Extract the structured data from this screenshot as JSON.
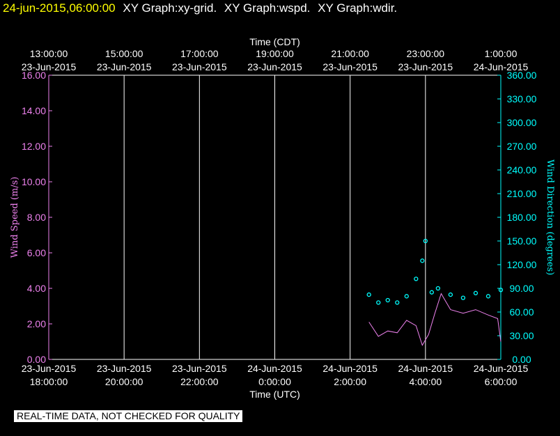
{
  "header": {
    "timestamp": "24-jun-2015,06:00:00",
    "titles": [
      "XY Graph:xy-grid.",
      "XY Graph:wspd.",
      "XY Graph:wdir."
    ]
  },
  "notice": "REAL-TIME DATA, NOT CHECKED FOR QUALITY",
  "colors": {
    "background": "#000000",
    "axes": "#ffffff",
    "grid": "#ffffff",
    "speed": "#ee82ee",
    "direction": "#00ffff",
    "timestamp": "#ffff00"
  },
  "chart_data": {
    "type": "line",
    "top_axis": {
      "label": "Time (CDT)",
      "ticks": [
        {
          "time": "13:00:00",
          "date": "23-Jun-2015"
        },
        {
          "time": "15:00:00",
          "date": "23-Jun-2015"
        },
        {
          "time": "17:00:00",
          "date": "23-Jun-2015"
        },
        {
          "time": "19:00:00",
          "date": "23-Jun-2015"
        },
        {
          "time": "21:00:00",
          "date": "23-Jun-2015"
        },
        {
          "time": "23:00:00",
          "date": "23-Jun-2015"
        },
        {
          "time": "1:00:00",
          "date": "24-Jun-2015"
        }
      ]
    },
    "bottom_axis": {
      "label": "Time (UTC)",
      "ticks": [
        {
          "date": "23-Jun-2015",
          "time": "18:00:00"
        },
        {
          "date": "23-Jun-2015",
          "time": "20:00:00"
        },
        {
          "date": "23-Jun-2015",
          "time": "22:00:00"
        },
        {
          "date": "24-Jun-2015",
          "time": "0:00:00"
        },
        {
          "date": "24-Jun-2015",
          "time": "2:00:00"
        },
        {
          "date": "24-Jun-2015",
          "time": "4:00:00"
        },
        {
          "date": "24-Jun-2015",
          "time": "6:00:00"
        }
      ],
      "range_utc": [
        "2015-06-23T18:00",
        "2015-06-24T06:00"
      ]
    },
    "left_axis": {
      "label": "Wind Speed (m/s)",
      "ylim": [
        0,
        16
      ],
      "ticks": [
        "0.00",
        "2.00",
        "4.00",
        "6.00",
        "8.00",
        "10.00",
        "12.00",
        "14.00",
        "16.00"
      ]
    },
    "right_axis": {
      "label": "Wind Direction (degrees)",
      "ylim": [
        0,
        360
      ],
      "ticks": [
        "0.00",
        "30.00",
        "60.00",
        "90.00",
        "120.00",
        "150.00",
        "180.00",
        "210.00",
        "240.00",
        "270.00",
        "300.00",
        "330.00",
        "360.00"
      ]
    },
    "grid": "vertical",
    "series": [
      {
        "name": "wspd",
        "style": "line",
        "axis": "left",
        "x": [
          "2015-06-24T02:30",
          "2015-06-24T02:45",
          "2015-06-24T03:00",
          "2015-06-24T03:15",
          "2015-06-24T03:30",
          "2015-06-24T03:45",
          "2015-06-24T03:55",
          "2015-06-24T04:05",
          "2015-06-24T04:15",
          "2015-06-24T04:25",
          "2015-06-24T04:40",
          "2015-06-24T05:00",
          "2015-06-24T05:20",
          "2015-06-24T05:40",
          "2015-06-24T05:55",
          "2015-06-24T06:00"
        ],
        "values": [
          2.1,
          1.3,
          1.6,
          1.5,
          2.2,
          1.9,
          0.8,
          1.4,
          2.6,
          3.7,
          2.8,
          2.6,
          2.8,
          2.5,
          2.3,
          1.0
        ]
      },
      {
        "name": "wdir",
        "style": "scatter",
        "axis": "right",
        "x": [
          "2015-06-24T02:30",
          "2015-06-24T02:45",
          "2015-06-24T03:00",
          "2015-06-24T03:15",
          "2015-06-24T03:30",
          "2015-06-24T03:45",
          "2015-06-24T03:55",
          "2015-06-24T04:00",
          "2015-06-24T04:10",
          "2015-06-24T04:20",
          "2015-06-24T04:40",
          "2015-06-24T05:00",
          "2015-06-24T05:20",
          "2015-06-24T05:40",
          "2015-06-24T06:00"
        ],
        "values": [
          82,
          72,
          75,
          72,
          80,
          102,
          125,
          150,
          85,
          90,
          82,
          78,
          84,
          80,
          88
        ]
      }
    ]
  }
}
